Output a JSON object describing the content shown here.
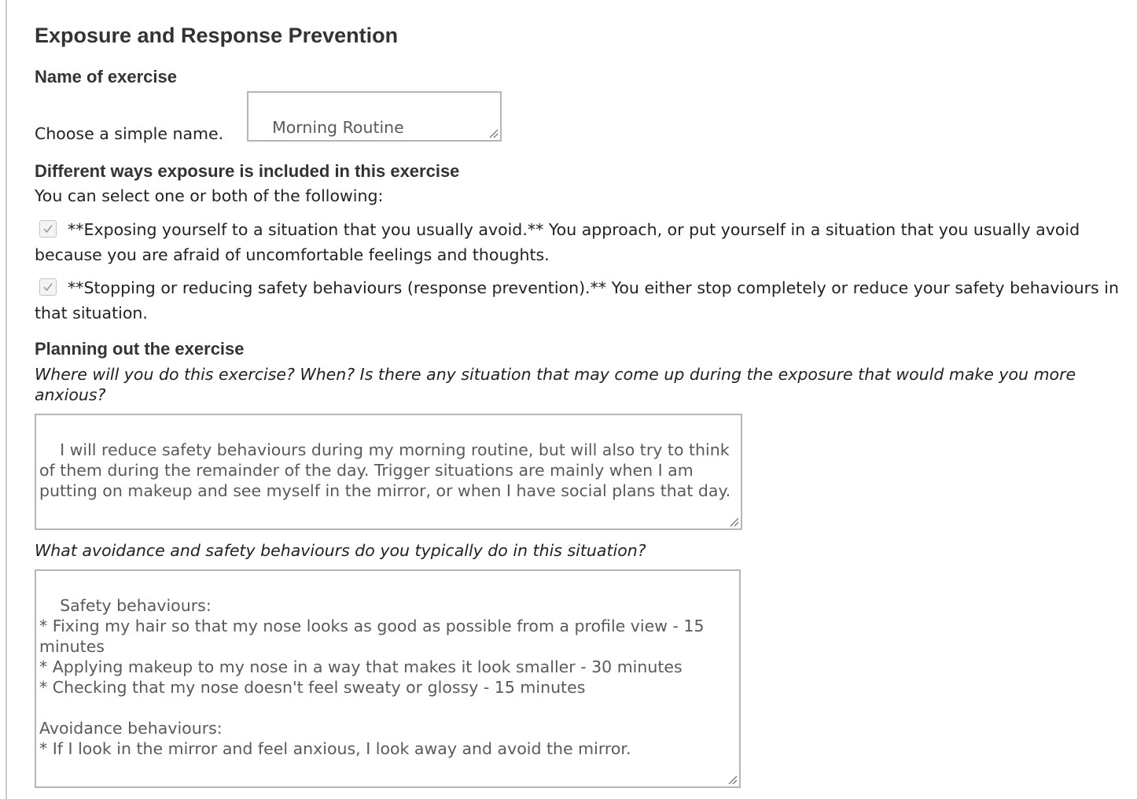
{
  "title": "Exposure and Response Prevention",
  "name_section": {
    "heading": "Name of exercise",
    "helper": "Choose a simple name.",
    "value": "Morning Routine"
  },
  "exposure_section": {
    "heading": "Different ways exposure is included in this exercise",
    "intro": "You can select one or both of the following:",
    "options": [
      {
        "checked": true,
        "text": "**Exposing yourself to a situation that you usually avoid.** You approach, or put yourself in a situation that you usually avoid because you are afraid of uncomfortable feelings and thoughts."
      },
      {
        "checked": true,
        "text": "**Stopping or reducing safety behaviours (response prevention).** You either stop completely or reduce your safety behaviours in that situation."
      }
    ]
  },
  "planning_section": {
    "heading": "Planning out the exercise",
    "question1": "Where will you do this exercise? When? Is there any situation that may come up during the exposure that would make you more anxious?",
    "answer1": "I will reduce safety behaviours during my morning routine, but will also try to think of them during the remainder of the day. Trigger situations are mainly when I am putting on makeup and see myself in the mirror, or when I have social plans that day.",
    "question2": "What avoidance and safety behaviours do you typically do in this situation?",
    "answer2": "Safety behaviours:\n* Fixing my hair so that my nose looks as good as possible from a profile view - 15 minutes\n* Applying makeup to my nose in a way that makes it look smaller - 30 minutes\n* Checking that my nose doesn't feel sweaty or glossy - 15 minutes\n\nAvoidance behaviours:\n* If I look in the mirror and feel anxious, I look away and avoid the mirror."
  }
}
